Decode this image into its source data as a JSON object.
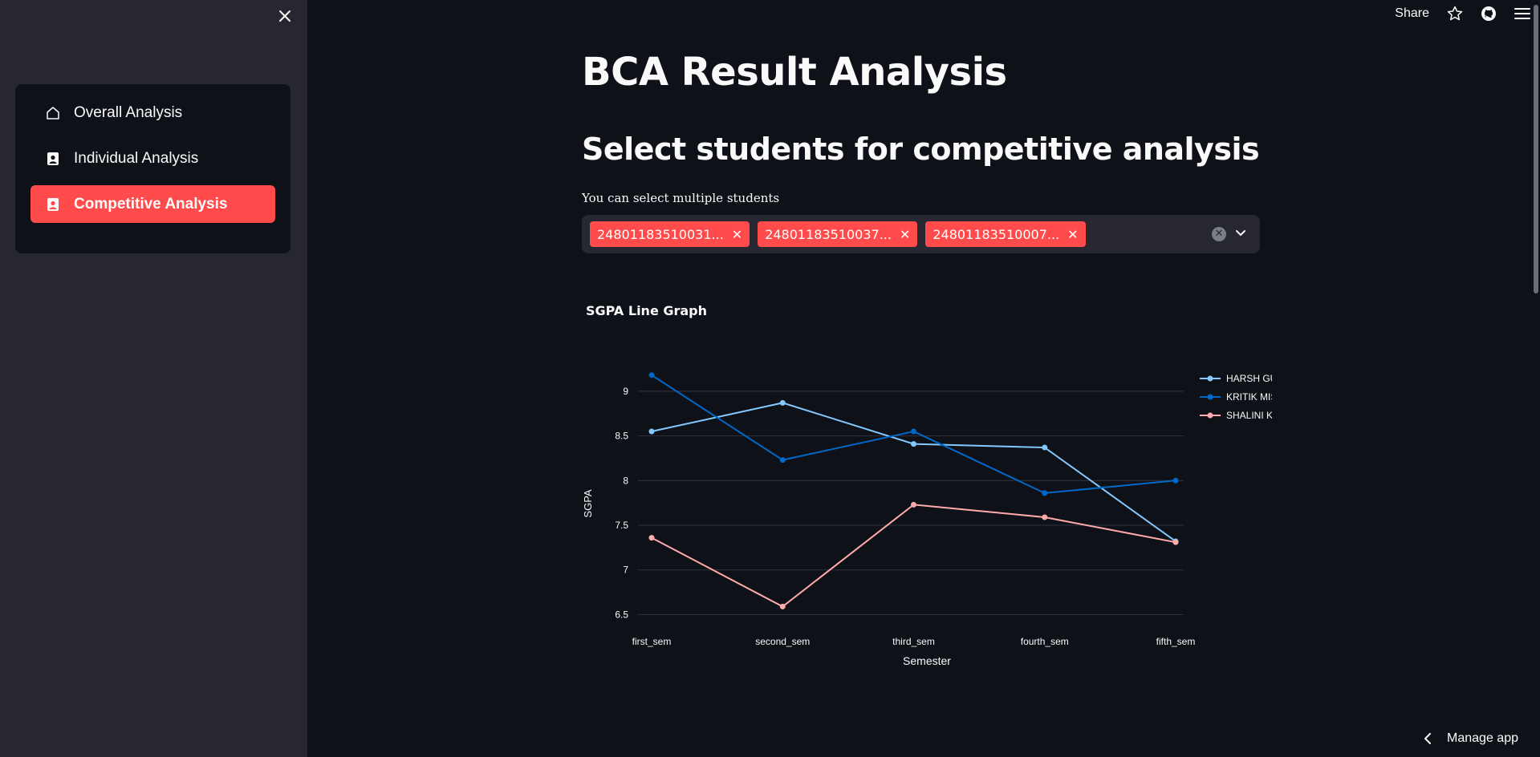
{
  "sidebar": {
    "items": [
      {
        "label": "Overall Analysis",
        "icon": "house-icon",
        "active": false
      },
      {
        "label": "Individual Analysis",
        "icon": "person-badge-icon",
        "active": false
      },
      {
        "label": "Competitive Analysis",
        "icon": "person-badge-icon",
        "active": true
      }
    ]
  },
  "topbar": {
    "share_label": "Share"
  },
  "main": {
    "title": "BCA Result Analysis",
    "subheading": "Select students for competitive analysis",
    "multiselect": {
      "label": "You can select multiple students",
      "selected": [
        "24801183510031...",
        "24801183510037...",
        "24801183510007..."
      ]
    },
    "chart_heading": "SGPA Line Graph"
  },
  "manage_label": "Manage app",
  "colors": {
    "accent": "#ff4b4b",
    "sidebar_bg": "#262730",
    "main_bg": "#0e1117"
  },
  "chart_data": {
    "type": "line",
    "title": "SGPA Line Graph",
    "xlabel": "Semester",
    "ylabel": "SGPA",
    "categories": [
      "first_sem",
      "second_sem",
      "third_sem",
      "fourth_sem",
      "fifth_sem"
    ],
    "ylim": [
      6.45,
      9.25
    ],
    "yticks": [
      6.5,
      7,
      7.5,
      8,
      8.5,
      9
    ],
    "ytick_labels": [
      "6.5",
      "7",
      "7.5",
      "8",
      "8.5",
      "9"
    ],
    "grid": true,
    "legend_position": "top-right",
    "series": [
      {
        "name": "HARSH GUPTA",
        "color": "#83c9ff",
        "values": [
          8.55,
          8.87,
          8.41,
          8.37,
          7.32
        ]
      },
      {
        "name": "KRITIK MISHRA",
        "color": "#0068c9",
        "values": [
          9.18,
          8.23,
          8.55,
          7.86,
          8.0
        ]
      },
      {
        "name": "SHALINI KOTHARI",
        "color": "#ffabab",
        "values": [
          7.36,
          6.59,
          7.73,
          7.59,
          7.31
        ]
      }
    ]
  }
}
